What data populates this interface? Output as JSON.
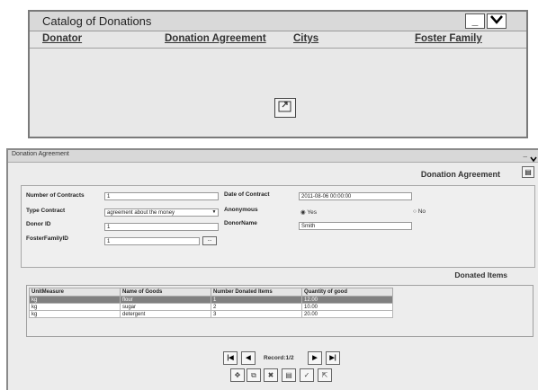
{
  "catalog": {
    "title": "Catalog of Donations",
    "minimize_label": "_",
    "dropdown_label": "✔",
    "columns": [
      "Donator",
      "Donation Agreement",
      "Citys",
      "Foster Family"
    ],
    "open_button_icon": "open-record-icon"
  },
  "agreement": {
    "window_title": "Donation Agreement",
    "heading": "Donation Agreement",
    "form": {
      "number_of_contracts_label": "Number of Contracts",
      "number_of_contracts_value": "1",
      "date_of_contract_label": "Date of Contract",
      "date_of_contract_value": "2011-08-06 00:00:00",
      "type_contract_label": "Type Contract",
      "type_contract_value": "agreement about the money",
      "anonymous_label": "Anonymous",
      "anonymous_yes": "Yes",
      "anonymous_no": "No",
      "donor_id_label": "Donor ID",
      "donor_id_value": "1",
      "donor_name_label": "DonorName",
      "donor_name_value": "Smith",
      "foster_family_id_label": "FosterFamilyID",
      "foster_family_id_value": "1",
      "lookup_label": "..."
    },
    "donated_items_label": "Donated Items",
    "items": {
      "headers": [
        "UnitMeasure",
        "Name of Goods",
        "Number Donated Items",
        "Quantity of good"
      ],
      "rows": [
        [
          "kg",
          "flour",
          "1",
          "12.00"
        ],
        [
          "kg",
          "sugar",
          "2",
          "10.00"
        ],
        [
          "kg",
          "detergent",
          "3",
          "20.00"
        ]
      ]
    },
    "record_label": "Record:1/2",
    "nav": {
      "first": "|◀",
      "prev": "◀",
      "next": "▶",
      "last": "▶|"
    },
    "actions": {
      "add": "✥",
      "copy": "⧉",
      "delete": "✖",
      "save": "▤",
      "confirm": "✓",
      "open": "⇱"
    }
  }
}
